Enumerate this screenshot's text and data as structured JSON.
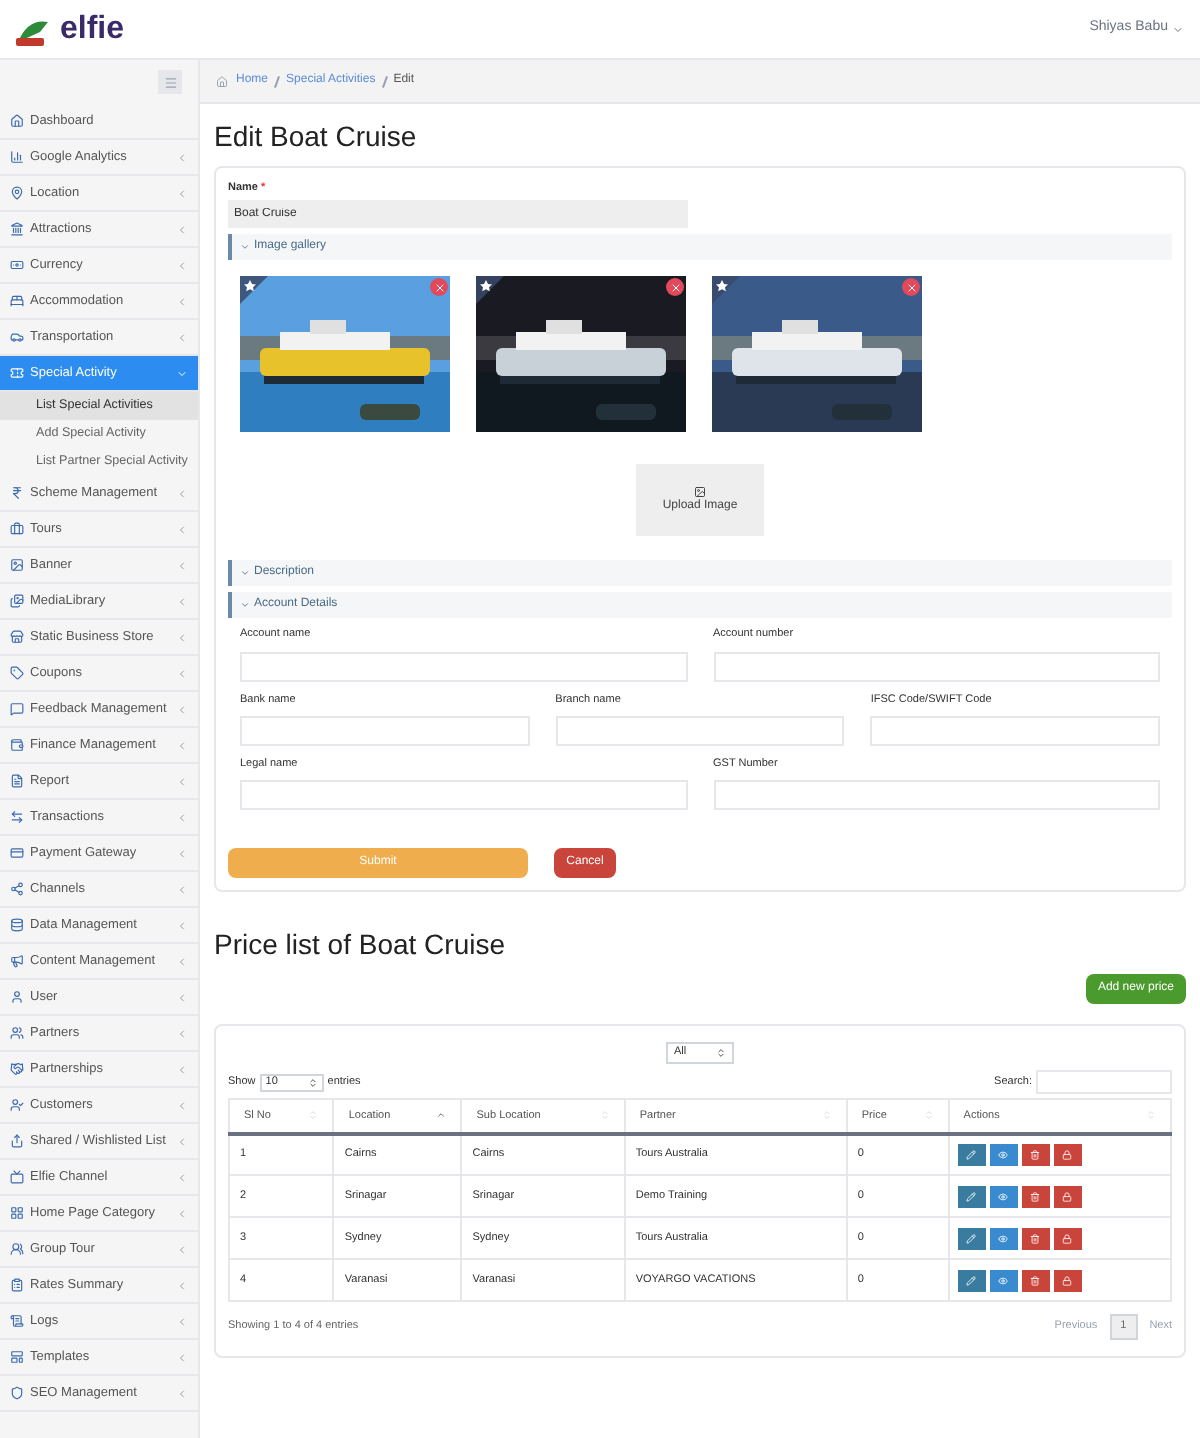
{
  "header": {
    "logo": "elfie",
    "user": "Shiyas Babu"
  },
  "sidebar": {
    "items": [
      {
        "label": "Dashboard",
        "expandable": false,
        "selected": false
      },
      {
        "label": "Google Analytics",
        "expandable": true,
        "selected": false
      },
      {
        "label": "Location",
        "expandable": true,
        "selected": false
      },
      {
        "label": "Attractions",
        "expandable": true,
        "selected": false
      },
      {
        "label": "Currency",
        "expandable": true,
        "selected": false
      },
      {
        "label": "Accommodation",
        "expandable": true,
        "selected": false
      },
      {
        "label": "Transportation",
        "expandable": true,
        "selected": false
      },
      {
        "label": "Special Activity",
        "expandable": true,
        "selected": true,
        "children": [
          {
            "label": "List Special Activities",
            "selected": true
          },
          {
            "label": "Add Special Activity",
            "selected": false
          },
          {
            "label": "List Partner Special Activity",
            "selected": false
          }
        ]
      },
      {
        "label": "Scheme Management",
        "expandable": true,
        "selected": false
      },
      {
        "label": "Tours",
        "expandable": true,
        "selected": false
      },
      {
        "label": "Banner",
        "expandable": true,
        "selected": false
      },
      {
        "label": "MediaLibrary",
        "expandable": true,
        "selected": false
      },
      {
        "label": "Static Business Store",
        "expandable": true,
        "selected": false
      },
      {
        "label": "Coupons",
        "expandable": true,
        "selected": false
      },
      {
        "label": "Feedback Management",
        "expandable": true,
        "selected": false
      },
      {
        "label": "Finance Management",
        "expandable": true,
        "selected": false
      },
      {
        "label": "Report",
        "expandable": true,
        "selected": false
      },
      {
        "label": "Transactions",
        "expandable": true,
        "selected": false
      },
      {
        "label": "Payment Gateway",
        "expandable": true,
        "selected": false
      },
      {
        "label": "Channels",
        "expandable": true,
        "selected": false
      },
      {
        "label": "Data Management",
        "expandable": true,
        "selected": false
      },
      {
        "label": "Content Management",
        "expandable": true,
        "selected": false
      },
      {
        "label": "User",
        "expandable": true,
        "selected": false
      },
      {
        "label": "Partners",
        "expandable": true,
        "selected": false
      },
      {
        "label": "Partnerships",
        "expandable": true,
        "selected": false
      },
      {
        "label": "Customers",
        "expandable": true,
        "selected": false
      },
      {
        "label": "Shared / Wishlisted List",
        "expandable": true,
        "selected": false
      },
      {
        "label": "Elfie Channel",
        "expandable": true,
        "selected": false
      },
      {
        "label": "Home Page Category",
        "expandable": true,
        "selected": false
      },
      {
        "label": "Group Tour",
        "expandable": true,
        "selected": false
      },
      {
        "label": "Rates Summary",
        "expandable": true,
        "selected": false
      },
      {
        "label": "Logs",
        "expandable": true,
        "selected": false
      },
      {
        "label": "Templates",
        "expandable": true,
        "selected": false
      },
      {
        "label": "SEO Management",
        "expandable": true,
        "selected": false
      }
    ]
  },
  "breadcrumb": [
    "Home",
    "Special Activities",
    "Edit"
  ],
  "title": "Edit Boat Cruise",
  "form": {
    "name_label": "Name",
    "required_mark": "*",
    "name_value": "Boat Cruise",
    "gallery": {
      "title": "Image gallery",
      "upload": "Upload Image"
    },
    "sections": [
      "Description",
      "Account Details"
    ],
    "field_rows": [
      [
        "Account name",
        "Account number"
      ],
      [
        "Bank name",
        "Branch name",
        "IFSC Code/SWIFT Code"
      ],
      [
        "Legal name",
        "GST Number"
      ]
    ],
    "submit": "Submit",
    "cancel": "Cancel"
  },
  "price_list": {
    "title": "Price list of Boat Cruise",
    "add_button": "Add new price",
    "filter": "All",
    "show": "Show",
    "page_size": "10",
    "entries": "entries",
    "search_label": "Search:",
    "columns": [
      {
        "label": "Sl No",
        "sorted": false
      },
      {
        "label": "Location",
        "sorted": true
      },
      {
        "label": "Sub Location",
        "sorted": false
      },
      {
        "label": "Partner",
        "sorted": false
      },
      {
        "label": "Price",
        "sorted": false
      },
      {
        "label": "Actions",
        "sorted": false
      }
    ],
    "rows": [
      [
        "1",
        "Cairns",
        "Cairns",
        "Tours Australia",
        "0"
      ],
      [
        "2",
        "Srinagar",
        "Srinagar",
        "Demo Training",
        "0"
      ],
      [
        "3",
        "Sydney",
        "Sydney",
        "Tours Australia",
        "0"
      ],
      [
        "4",
        "Varanasi",
        "Varanasi",
        "VOYARGO VACATIONS",
        "0"
      ]
    ],
    "info": "Showing 1 to 4 of 4 entries",
    "prev": "Previous",
    "page": "1",
    "next": "Next"
  }
}
